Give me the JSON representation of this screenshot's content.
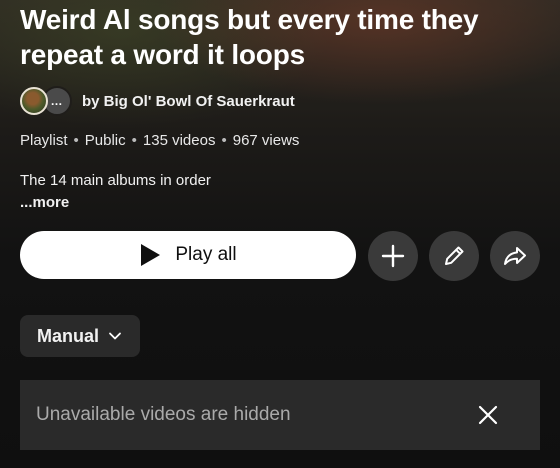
{
  "playlist": {
    "title": "Weird Al songs but every time they repeat a word it loops",
    "owner": "by Big Ol' Bowl Of Sauerkraut",
    "more_avatars_icon": "…",
    "meta": {
      "type": "Playlist",
      "visibility": "Public",
      "video_count": "135 videos",
      "views": "967 views"
    },
    "description": "The 14 main albums in order",
    "more_label": "...more"
  },
  "actions": {
    "play_all_label": "Play all",
    "play_icon": "play-icon",
    "add_icon": "plus-icon",
    "edit_icon": "pencil-icon",
    "share_icon": "share-arrow-icon"
  },
  "sort": {
    "selected": "Manual",
    "icon": "chevron-down-icon"
  },
  "notice": {
    "text": "Unavailable videos are hidden",
    "close_icon": "close-icon"
  },
  "colors": {
    "background": "#0f0f0f",
    "button_primary": "#ffffff",
    "button_secondary": "#3a3a3a",
    "chip": "#2a2a2a",
    "muted_text": "#aaaaaa"
  }
}
